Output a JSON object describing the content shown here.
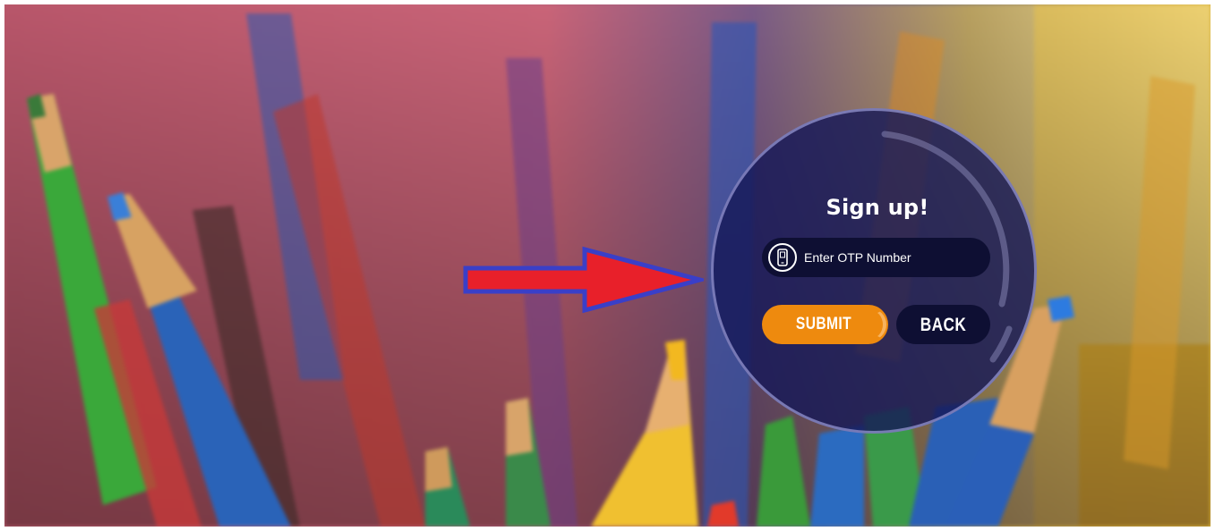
{
  "signup": {
    "title": "Sign up!",
    "otp_placeholder": "Enter OTP Number",
    "otp_value": "",
    "phone_icon": "mobile-phone-icon",
    "submit_label": "SUBMIT",
    "back_label": "BACK"
  },
  "colors": {
    "panel": "#161858",
    "field": "#0e0f33",
    "submit": "#ee8a0e",
    "arrow_fill": "#e8202a",
    "arrow_stroke": "#3a3fc8"
  }
}
